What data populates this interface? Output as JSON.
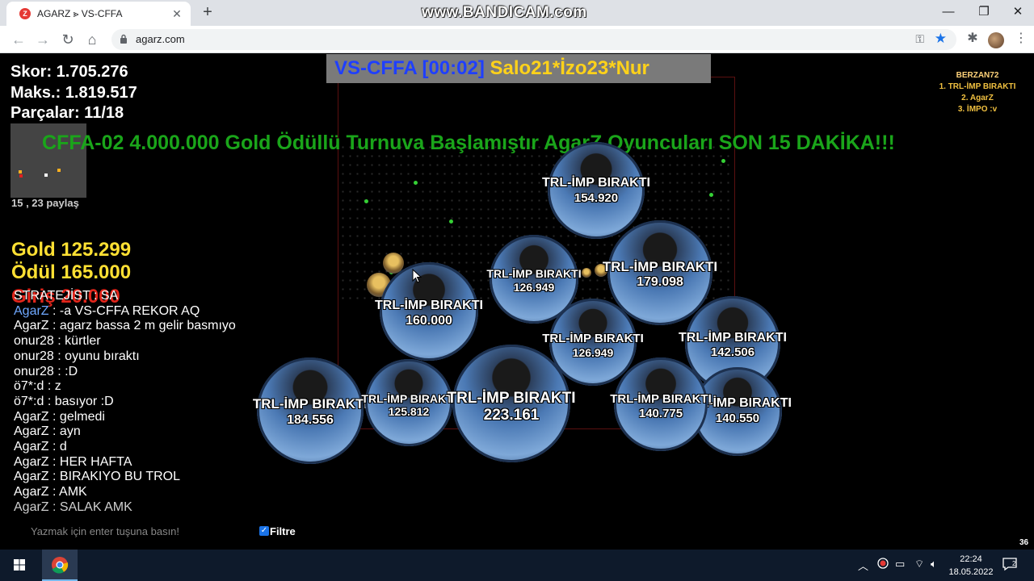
{
  "browser": {
    "tab_title": "AGARZ ⪢ VS-CFFA",
    "favicon_letter": "Z",
    "url": "agarz.com",
    "watermark": "www.BANDICAM.com"
  },
  "game": {
    "room_label": "VS-CFFA [00:02]",
    "room_players": "Salo21*İzo23*Nur",
    "score": "Skor: 1.705.276",
    "max_score": "Maks.: 1.819.517",
    "pieces": "Parçalar: 11/18",
    "share": "15 , 23 paylaş",
    "announcement": "CFFA-02  4.000.000  Gold Ödüllü Turnuva Başlamıştır AgarZ Oyuncuları SON 15 DAKİKA!!!",
    "gold": "Gold 125.299",
    "reward": "Ödül 165.000",
    "entry": "Giriş 20.000",
    "leaderboard": {
      "title": "BERZAN72",
      "items": [
        "1. TRL-İMP BIRAKTI",
        "2. AgarZ",
        "3. İMPO :v"
      ]
    },
    "chat": [
      {
        "name": "STRATEJİST",
        "text": " : SA"
      },
      {
        "name": "AgarZ",
        "text": " : -a VS-CFFA REKOR AQ"
      },
      {
        "name": "AgarZ",
        "text": " : agarz bassa 2 m gelir basmıyo"
      },
      {
        "name": "onur28",
        "text": " : kürtler"
      },
      {
        "name": "onur28",
        "text": " : oyunu bıraktı"
      },
      {
        "name": "onur28",
        "text": " : :D"
      },
      {
        "name": "ö7*:d",
        "text": " : z"
      },
      {
        "name": "ö7*:d",
        "text": " : basıyor :D"
      },
      {
        "name": "AgarZ",
        "text": " : gelmedi"
      },
      {
        "name": "AgarZ",
        "text": " : ayn"
      },
      {
        "name": "AgarZ",
        "text": " : d"
      },
      {
        "name": "AgarZ",
        "text": " : HER HAFTA"
      },
      {
        "name": "AgarZ",
        "text": " : BIRAKIYO BU TROL"
      },
      {
        "name": "AgarZ",
        "text": " : AMK"
      },
      {
        "name": "AgarZ",
        "text": " : SALAK AMK"
      }
    ],
    "chat_placeholder": "Yazmak için enter tuşuna basın!",
    "filter_label": "Filtre",
    "fps": "36",
    "cells": [
      {
        "name": "TRL-İMP BIRAKTI",
        "mass": "154.920"
      },
      {
        "name": "TRL-İMP BIRAKTI",
        "mass": "126.949"
      },
      {
        "name": "TRL-İMP BIRAKTI",
        "mass": "179.098"
      },
      {
        "name": "TRL-İMP BIRAKTI",
        "mass": "160.000"
      },
      {
        "name": "TRL-İMP BIRAKTI",
        "mass": "126.949"
      },
      {
        "name": "TRL-İMP BIRAKTI",
        "mass": "142.506"
      },
      {
        "name": "TRL-İMP BIRAKTI",
        "mass": "184.556"
      },
      {
        "name": "TRL-İMP BIRAKTI",
        "mass": "125.812"
      },
      {
        "name": "TRL-İMP BIRAKTI",
        "mass": "223.161"
      },
      {
        "name": "TRL-İMP BIRAKTI",
        "mass": "140.550"
      },
      {
        "name": "TRL-İMP BIRAKTI",
        "mass": "140.775"
      }
    ]
  },
  "taskbar": {
    "time": "22:24",
    "date": "18.05.2022",
    "notification_count": "2"
  }
}
